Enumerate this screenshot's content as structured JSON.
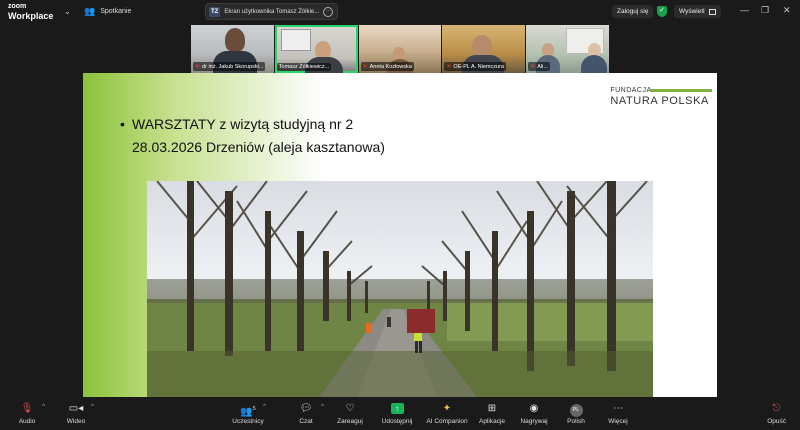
{
  "app": {
    "brand_top": "zoom",
    "brand_bottom": "Workplace"
  },
  "topbar": {
    "meeting_label": "Spotkanie",
    "viewing_initials": "TZ",
    "viewing_label": "Ekran użytkownika Tomasz Żółkie...",
    "signin_label": "Zaloguj się",
    "view_label": "Wyświetl"
  },
  "participants": [
    {
      "name": "dr inż. Jakub Skorupski...",
      "muted": true
    },
    {
      "name": "Tomasz Żółkiewicz...",
      "muted": false,
      "active": true
    },
    {
      "name": "Aneta Kozłowska",
      "muted": true
    },
    {
      "name": "OE-PL A. Niemczura",
      "muted": true
    },
    {
      "name": "Ali...",
      "muted": true
    }
  ],
  "slide": {
    "logo_line1": "FUNDACJA",
    "logo_line2": "NATURA POLSKA",
    "bullet_line1": "WARSZTATY z wizytą studyjną nr 2",
    "bullet_line2": "28.03.2026 Drzeniów (aleja kasztanowa)"
  },
  "toolbar": {
    "audio": "Audio",
    "video": "Wideo",
    "participants": "Uczestnicy",
    "participants_count": "5",
    "chat": "Czat",
    "react": "Zareaguj",
    "share": "Udostępnij",
    "ai": "AI Companion",
    "apps": "Aplikacje",
    "record": "Nagrywaj",
    "language": "Polish",
    "language_initials": "PL",
    "more": "Więcej",
    "leave": "Opuść"
  },
  "colors": {
    "accent_green": "#2bd46a",
    "danger": "#e54b4b",
    "share": "#19b35b",
    "logo_green": "#7cb342"
  }
}
